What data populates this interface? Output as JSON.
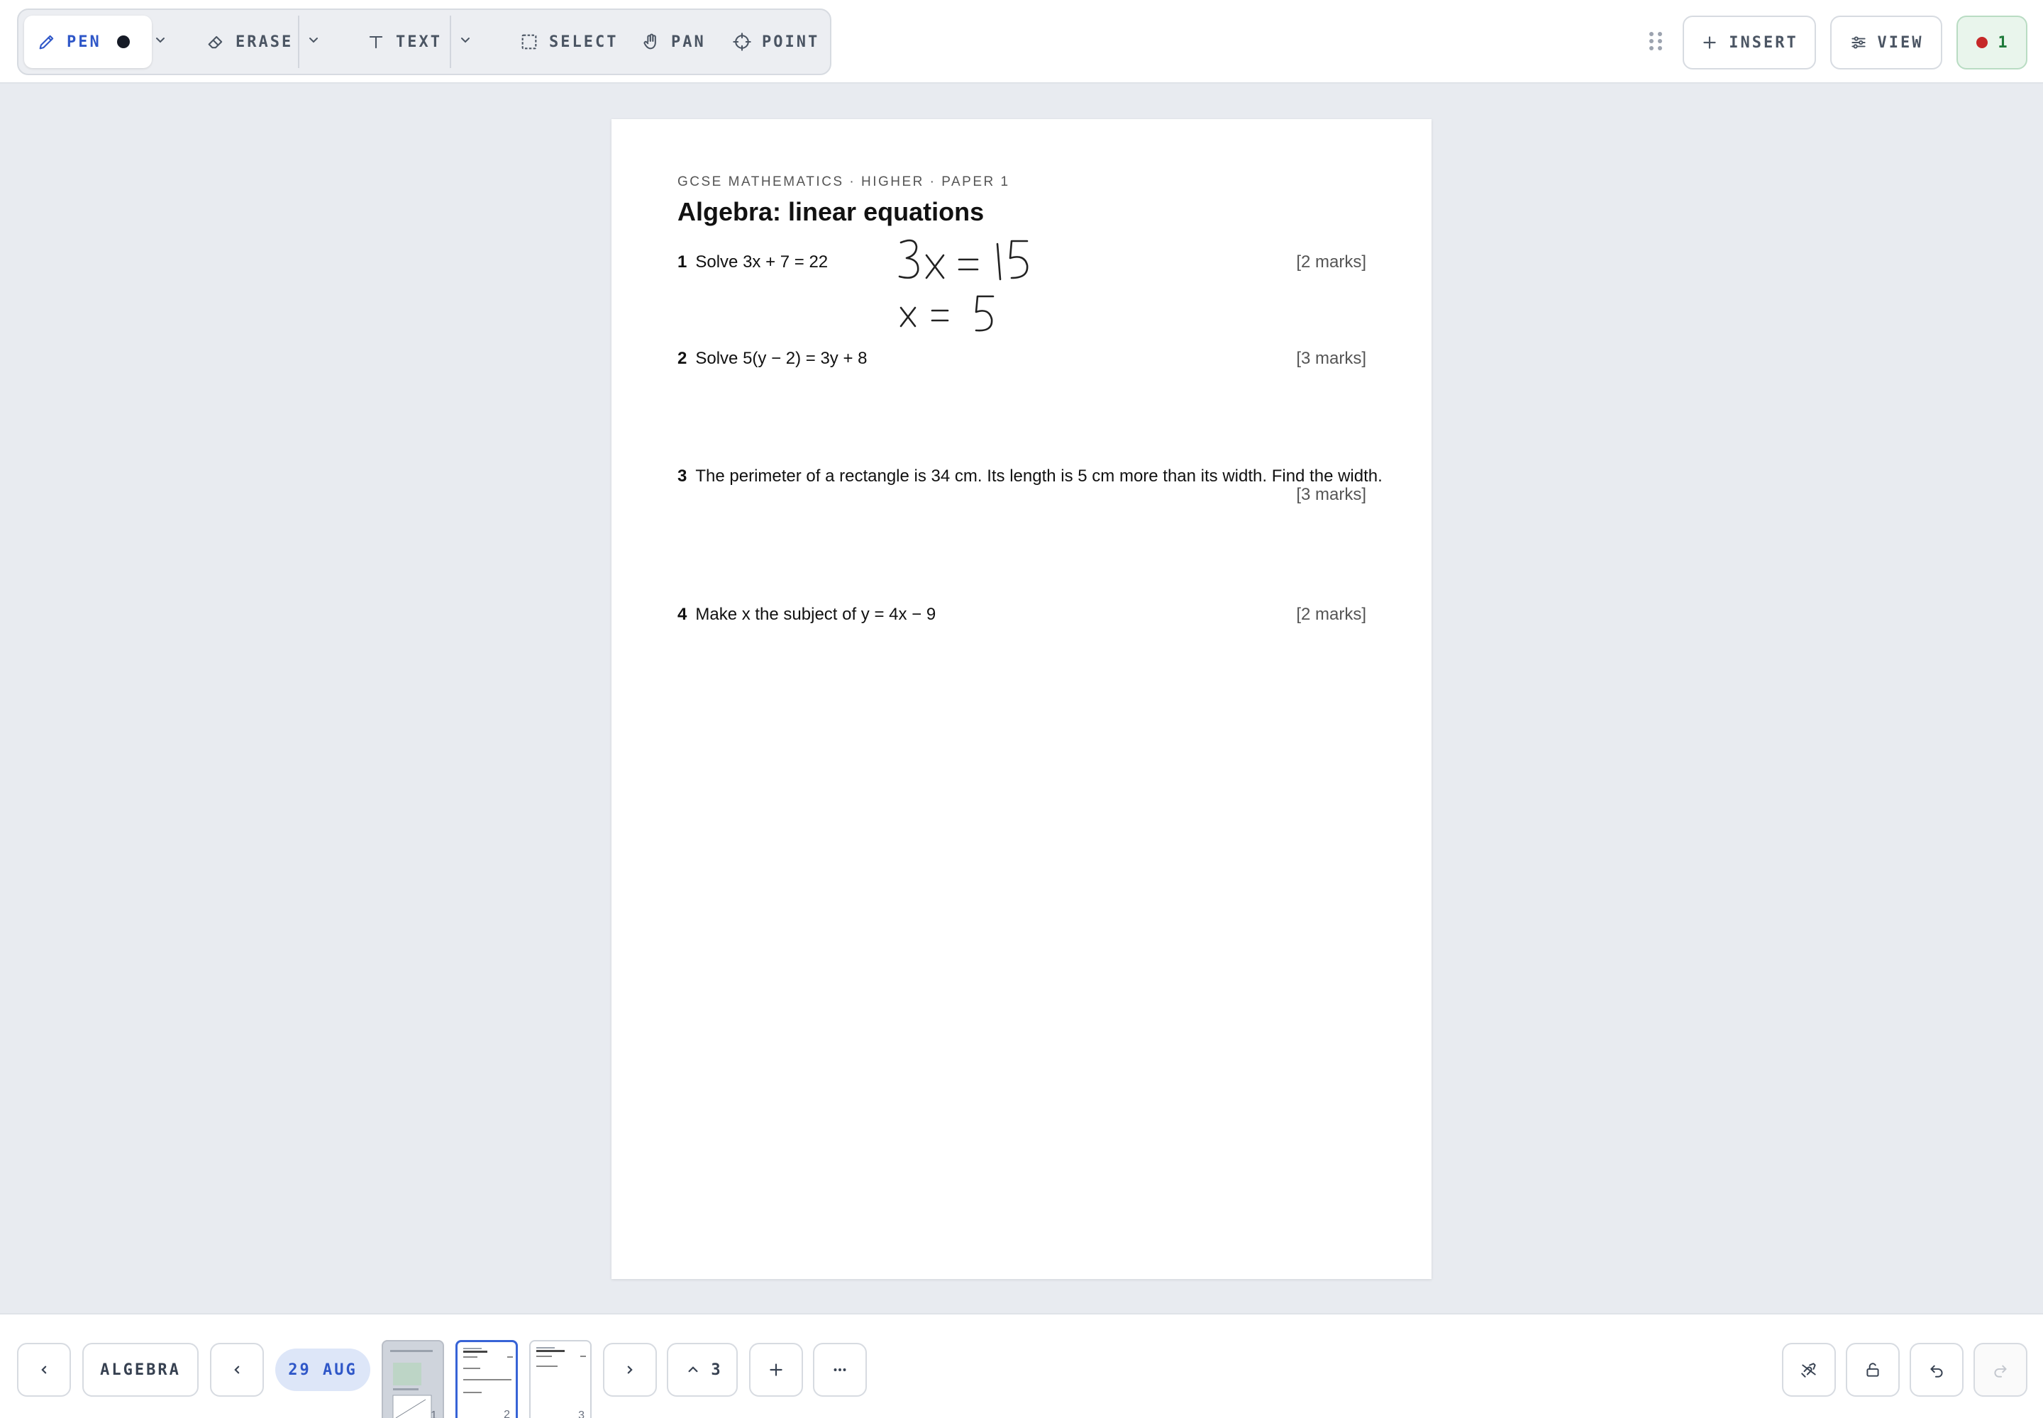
{
  "toolbar": {
    "tools": {
      "pen": "PEN",
      "erase": "ERASE",
      "text": "TEXT",
      "select": "SELECT",
      "pan": "PAN",
      "point": "POINT"
    },
    "active_tool": "pen",
    "pen_color": "#161b26",
    "accent_color": "#2f57c8",
    "insert_label": "INSERT",
    "view_label": "VIEW",
    "recording_count": "1",
    "recording_color": "#c62828"
  },
  "page": {
    "header": "GCSE MATHEMATICS · HIGHER · PAPER 1",
    "title": "Algebra: linear equations",
    "questions": [
      {
        "num": "1",
        "text": "Solve  3x + 7 = 22",
        "marks": "[2 marks]"
      },
      {
        "num": "2",
        "text": "Solve  5(y − 2) = 3y + 8",
        "marks": "[3 marks]"
      },
      {
        "num": "3",
        "text": "The perimeter of a rectangle is 34 cm. Its length is 5 cm more than its width. Find the width.",
        "marks": "[3 marks]"
      },
      {
        "num": "4",
        "text": "Make x the subject of  y = 4x − 9",
        "marks": "[2 marks]"
      }
    ],
    "handwriting": [
      "3x = 15",
      "x = 5"
    ]
  },
  "bottombar": {
    "section_label": "ALGEBRA",
    "date_label": "29 AUG",
    "page_count": "3",
    "thumbnails": [
      "1",
      "2",
      "3"
    ],
    "current_page": "2"
  }
}
